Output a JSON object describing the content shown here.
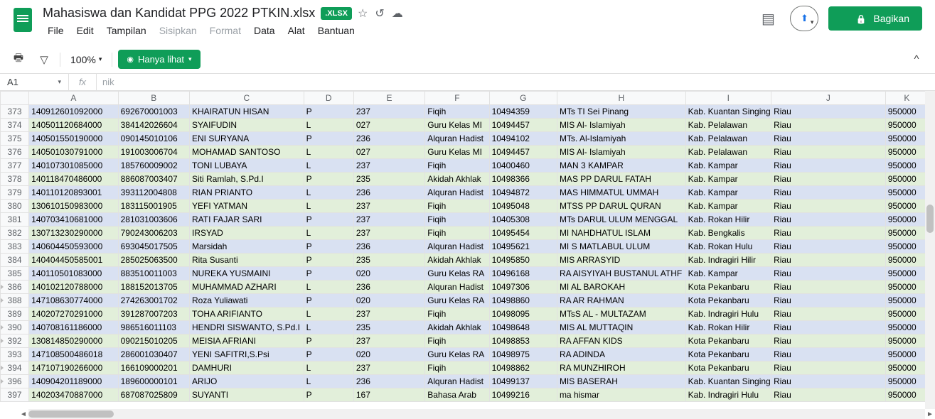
{
  "header": {
    "title": "Mahasiswa dan Kandidat PPG 2022 PTKIN.xlsx",
    "badge": ".XLSX",
    "menus": [
      "File",
      "Edit",
      "Tampilan",
      "Sisipkan",
      "Format",
      "Data",
      "Alat",
      "Bantuan"
    ],
    "disabled_menus": [
      "Sisipkan",
      "Format"
    ],
    "share": "Bagikan"
  },
  "toolbar": {
    "zoom": "100%",
    "view_mode": "Hanya lihat"
  },
  "cellref": {
    "ref": "A1",
    "fx": "fx",
    "formula": "nik"
  },
  "columns": [
    "A",
    "B",
    "C",
    "D",
    "E",
    "F",
    "G",
    "H",
    "I",
    "J",
    "K"
  ],
  "triangle_rows": [
    386,
    388,
    390,
    392,
    394,
    396
  ],
  "rows": [
    {
      "n": 373,
      "c": "blue",
      "v": [
        "140912601092000",
        "692670001003",
        "KHAIRATUN HISAN",
        "P",
        "237",
        "Fiqih",
        "10494359",
        "MTs TI Sei Pinang",
        "Kab. Kuantan Singing",
        "Riau",
        "950000"
      ]
    },
    {
      "n": 374,
      "c": "green",
      "v": [
        "140501120684000",
        "384142026604",
        "SYAIFUDIN",
        "L",
        "027",
        "Guru Kelas MI",
        "10494457",
        "MIS Al- Islamiyah",
        "Kab. Pelalawan",
        "Riau",
        "950000"
      ]
    },
    {
      "n": 375,
      "c": "blue",
      "v": [
        "140501550190000",
        "090145010106",
        "ENI SURYANA",
        "P",
        "236",
        "Alquran Hadist",
        "10494102",
        "MTs. Al-Islamiyah",
        "Kab. Pelalawan",
        "Riau",
        "950000"
      ]
    },
    {
      "n": 376,
      "c": "green",
      "v": [
        "140501030791000",
        "191003006704",
        "MOHAMAD SANTOSO",
        "L",
        "027",
        "Guru Kelas MI",
        "10494457",
        "MIS Al- Islamiyah",
        "Kab. Pelalawan",
        "Riau",
        "950000"
      ]
    },
    {
      "n": 377,
      "c": "blue",
      "v": [
        "140107301085000",
        "185760009002",
        "TONI LUBAYA",
        "L",
        "237",
        "Fiqih",
        "10400460",
        "MAN 3 KAMPAR",
        "Kab. Kampar",
        "Riau",
        "950000"
      ]
    },
    {
      "n": 378,
      "c": "green",
      "v": [
        "140118470486000",
        "886087003407",
        "Siti Ramlah, S.Pd.I",
        "P",
        "235",
        "Akidah Akhlak",
        "10498366",
        "MAS PP DARUL FATAH",
        "Kab. Kampar",
        "Riau",
        "950000"
      ]
    },
    {
      "n": 379,
      "c": "blue",
      "v": [
        "140110120893001",
        "393112004808",
        "RIAN PRIANTO",
        "L",
        "236",
        "Alquran Hadist",
        "10494872",
        "MAS HIMMATUL UMMAH",
        "Kab. Kampar",
        "Riau",
        "950000"
      ]
    },
    {
      "n": 380,
      "c": "green",
      "v": [
        "130610150983000",
        "183115001905",
        "YEFI YATMAN",
        "L",
        "237",
        "Fiqih",
        "10495048",
        "MTSS PP DARUL QURAN",
        "Kab. Kampar",
        "Riau",
        "950000"
      ]
    },
    {
      "n": 381,
      "c": "blue",
      "v": [
        "140703410681000",
        "281031003606",
        "RATI FAJAR SARI",
        "P",
        "237",
        "Fiqih",
        "10405308",
        "MTs DARUL ULUM MENGGAL",
        "Kab. Rokan Hilir",
        "Riau",
        "950000"
      ]
    },
    {
      "n": 382,
      "c": "green",
      "v": [
        "130713230290000",
        "790243006203",
        "IRSYAD",
        "L",
        "237",
        "Fiqih",
        "10495454",
        "MI NAHDHATUL ISLAM",
        "Kab. Bengkalis",
        "Riau",
        "950000"
      ]
    },
    {
      "n": 383,
      "c": "blue",
      "v": [
        "140604450593000",
        "693045017505",
        "Marsidah",
        "P",
        "236",
        "Alquran Hadist",
        "10495621",
        "MI S MATLABUL ULUM",
        "Kab. Rokan Hulu",
        "Riau",
        "950000"
      ]
    },
    {
      "n": 384,
      "c": "green",
      "v": [
        "140404450585001",
        "285025063500",
        "Rita Susanti",
        "P",
        "235",
        "Akidah Akhlak",
        "10495850",
        "MIS ARRASYID",
        "Kab. Indragiri Hilir",
        "Riau",
        "950000"
      ]
    },
    {
      "n": 385,
      "c": "blue",
      "v": [
        "140110501083000",
        "883510011003",
        "NUREKA YUSMAINI",
        "P",
        "020",
        "Guru Kelas RA",
        "10496168",
        "RA AISYIYAH BUSTANUL ATHF",
        "Kab. Kampar",
        "Riau",
        "950000"
      ]
    },
    {
      "n": 386,
      "c": "green",
      "v": [
        "140102120788000",
        "188152013705",
        "MUHAMMAD AZHARI",
        "L",
        "236",
        "Alquran Hadist",
        "10497306",
        "MI AL BAROKAH",
        "Kota Pekanbaru",
        "Riau",
        "950000"
      ]
    },
    {
      "n": 388,
      "c": "blue",
      "v": [
        "147108630774000",
        "274263001702",
        "Roza Yuliawati",
        "P",
        "020",
        "Guru Kelas RA",
        "10498860",
        "RA AR RAHMAN",
        "Kota Pekanbaru",
        "Riau",
        "950000"
      ]
    },
    {
      "n": 389,
      "c": "green",
      "v": [
        "140207270291000",
        "391287007203",
        "TOHA ARIFIANTO",
        "L",
        "237",
        "Fiqih",
        "10498095",
        "MTsS  AL - MULTAZAM",
        "Kab. Indragiri Hulu",
        "Riau",
        "950000"
      ]
    },
    {
      "n": 390,
      "c": "blue",
      "v": [
        "140708161186000",
        "986516011103",
        "HENDRI SISWANTO, S.Pd.I",
        "L",
        "235",
        "Akidah Akhlak",
        "10498648",
        "MIS AL MUTTAQIN",
        "Kab. Rokan Hilir",
        "Riau",
        "950000"
      ]
    },
    {
      "n": 392,
      "c": "green",
      "v": [
        "130814850290000",
        "090215010205",
        "MEISIA AFRIANI",
        "P",
        "237",
        "Fiqih",
        "10498853",
        "RA AFFAN KIDS",
        "Kota Pekanbaru",
        "Riau",
        "950000"
      ]
    },
    {
      "n": 393,
      "c": "blue",
      "v": [
        "147108500486018",
        "286001030407",
        "YENI SAFITRI,S.Psi",
        "P",
        "020",
        "Guru Kelas RA",
        "10498975",
        "RA ADINDA",
        "Kota Pekanbaru",
        "Riau",
        "950000"
      ]
    },
    {
      "n": 394,
      "c": "green",
      "v": [
        "147107190266000",
        "166109000201",
        "DAMHURI",
        "L",
        "237",
        "Fiqih",
        "10498862",
        "RA MUNZHIROH",
        "Kota Pekanbaru",
        "Riau",
        "950000"
      ]
    },
    {
      "n": 396,
      "c": "blue",
      "v": [
        "140904201189000",
        "189600000101",
        "ARIJO",
        "L",
        "236",
        "Alquran Hadist",
        "10499137",
        "MIS BASERAH",
        "Kab. Kuantan Singing",
        "Riau",
        "950000"
      ]
    },
    {
      "n": 397,
      "c": "green",
      "v": [
        "140203470887000",
        "687087025809",
        "SUYANTI",
        "P",
        "167",
        "Bahasa Arab",
        "10499216",
        "ma hismar",
        "Kab. Indragiri Hulu",
        "Riau",
        "950000"
      ]
    }
  ]
}
